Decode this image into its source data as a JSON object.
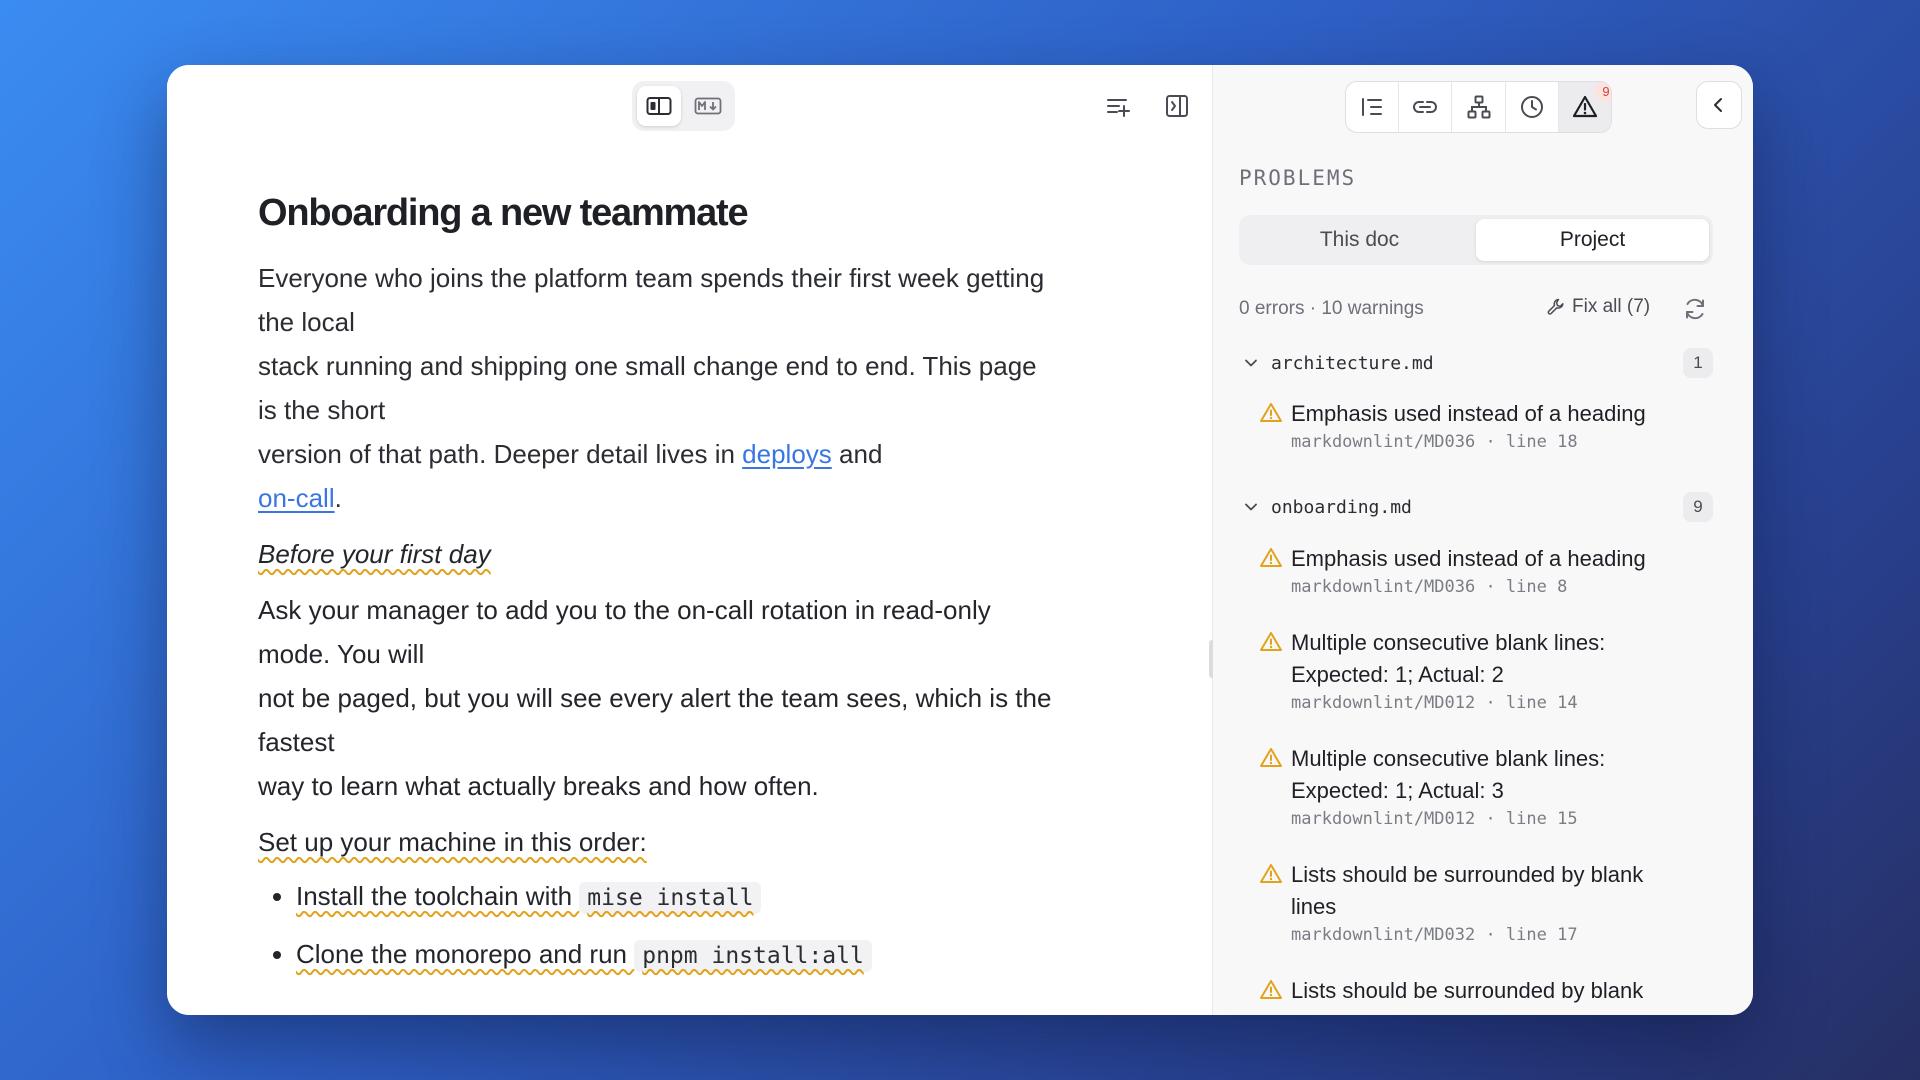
{
  "editor": {
    "modes": [
      {
        "name": "wysiwyg",
        "icon": "split-preview-icon",
        "active": true
      },
      {
        "name": "markdown",
        "icon": "markdown-icon",
        "active": false
      }
    ],
    "toolbar_icons": [
      "outline-add-icon",
      "sidebar-toggle-icon"
    ],
    "doc": {
      "title": "Onboarding a new teammate",
      "intro_lines": [
        "Everyone who joins the platform team spends their first week getting",
        "the local",
        "stack running and shipping one small change end to end. This page",
        "is the short"
      ],
      "intro_line5_prefix": "version of that path. Deeper detail lives in ",
      "link_deploys": "deploys",
      "intro_line5_suffix": " and",
      "link_oncall": "on-call",
      "intro_end": ".",
      "subheading": "Before your first day",
      "para2_lines": [
        "Ask your manager to add you to the on-call rotation in read-only",
        "mode. You will",
        "not be paged, but you will see every alert the team sees, which is the",
        "fastest",
        "way to learn what actually breaks and how often."
      ],
      "setup_label": "Set up your machine in this order:",
      "steps": [
        {
          "text": "Install the toolchain with ",
          "code": "mise install"
        },
        {
          "text": "Clone the monorepo and run ",
          "code": "pnpm install:all"
        }
      ]
    }
  },
  "panel": {
    "tabs": [
      {
        "icon": "outline-list-icon",
        "active": false
      },
      {
        "icon": "link-icon",
        "active": false
      },
      {
        "icon": "hierarchy-icon",
        "active": false
      },
      {
        "icon": "history-clock-icon",
        "active": false
      },
      {
        "icon": "warning-icon",
        "active": true,
        "badge": "9"
      }
    ],
    "collapse_icon": "chevron-left-icon",
    "title": "PROBLEMS",
    "scope_options": [
      "This doc",
      "Project"
    ],
    "scope_selected": "Project",
    "summary": "0 errors · 10 warnings",
    "fix_all": "Fix all (7)",
    "groups": [
      {
        "file": "architecture.md",
        "count": "1",
        "issues": [
          {
            "message": [
              "Emphasis used instead of a heading"
            ],
            "rule": "markdownlint/MD036 · line 18"
          }
        ]
      },
      {
        "file": "onboarding.md",
        "count": "9",
        "issues": [
          {
            "message": [
              "Emphasis used instead of a heading"
            ],
            "rule": "markdownlint/MD036 · line 8"
          },
          {
            "message": [
              "Multiple consecutive blank lines:",
              "Expected: 1; Actual: 2"
            ],
            "rule": "markdownlint/MD012 · line 14"
          },
          {
            "message": [
              "Multiple consecutive blank lines:",
              "Expected: 1; Actual: 3"
            ],
            "rule": "markdownlint/MD012 · line 15"
          },
          {
            "message": [
              "Lists should be surrounded by blank",
              "lines"
            ],
            "rule": "markdownlint/MD032 · line 17"
          },
          {
            "message": [
              "Lists should be surrounded by blank"
            ],
            "rule": ""
          }
        ]
      }
    ]
  },
  "colors": {
    "link": "#3a76e2",
    "warning": "#e3a21b",
    "badge_text": "#d1453b"
  }
}
